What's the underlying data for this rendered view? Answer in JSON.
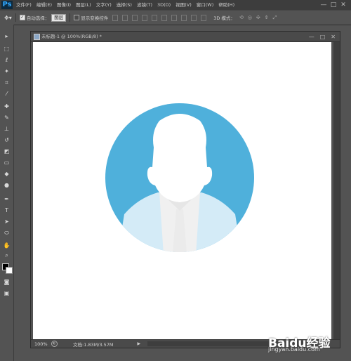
{
  "app": {
    "logo": "Ps"
  },
  "menubar": {
    "items": [
      {
        "label": "文件(F)"
      },
      {
        "label": "编辑(E)"
      },
      {
        "label": "图像(I)"
      },
      {
        "label": "图层(L)"
      },
      {
        "label": "文字(Y)"
      },
      {
        "label": "选择(S)"
      },
      {
        "label": "滤镜(T)"
      },
      {
        "label": "3D(D)"
      },
      {
        "label": "视图(V)"
      },
      {
        "label": "窗口(W)"
      },
      {
        "label": "帮助(H)"
      }
    ],
    "window_controls": [
      "—",
      "□",
      "✕"
    ]
  },
  "options_bar": {
    "tool_icon": "move-tool-icon",
    "auto_select_label": "自动选择：",
    "auto_select_value": "图层",
    "show_transform_label": "显示变换控件",
    "mode_label": "3D 模式："
  },
  "document": {
    "title": "未标题-1 @ 100%(RGB/8) *",
    "controls": [
      "—",
      "□",
      "✕"
    ],
    "zoom": "100%",
    "doc_info": "文档:1.83M/3.57M",
    "canvas_color": "#ffffff"
  },
  "illustration": {
    "circle_color": "#4fb0db",
    "head_color": "#ffffff",
    "shirt_color": "#d4ebf7",
    "collar_color": "#f0f0f0",
    "tie_color": "#ebebeb"
  },
  "watermark": {
    "brand": "Baidu经验",
    "url": "jingyan.baidu.com"
  }
}
